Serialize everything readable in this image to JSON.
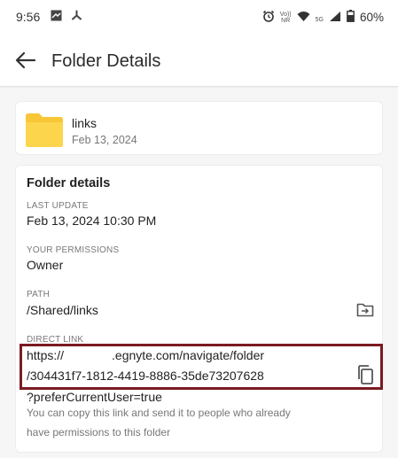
{
  "status_bar": {
    "time": "9:56",
    "volte_top": "Vo))",
    "volte_bottom": "NR",
    "network_type": "5G",
    "battery": "60%"
  },
  "app_bar": {
    "title": "Folder Details"
  },
  "folder": {
    "name": "links",
    "date": "Feb 13, 2024",
    "icon_color": "#fdd54d"
  },
  "details": {
    "title": "Folder details",
    "last_update_label": "LAST UPDATE",
    "last_update_value": "Feb 13, 2024 10:30 PM",
    "permissions_label": "YOUR PERMISSIONS",
    "permissions_value": "Owner",
    "path_label": "PATH",
    "path_value": "/Shared/links",
    "direct_link_label": "DIRECT LINK",
    "link_prefix": "https://",
    "link_domain": ".egnyte.com/navigate/folder",
    "link_id": "/304431f7-1812-4419-8886-35de73207628",
    "link_query": "?preferCurrentUser=true",
    "hint_line1": "You can copy this link and send it to people who already",
    "hint_line2": "have permissions to this folder"
  },
  "colors": {
    "highlight_border": "#7a1a22",
    "folder": "#fdd54d"
  },
  "icons": [
    "arrow-back-icon",
    "folder-icon",
    "move-folder-icon",
    "copy-icon",
    "alarm-icon",
    "wifi-icon",
    "signal-icon",
    "battery-icon"
  ]
}
